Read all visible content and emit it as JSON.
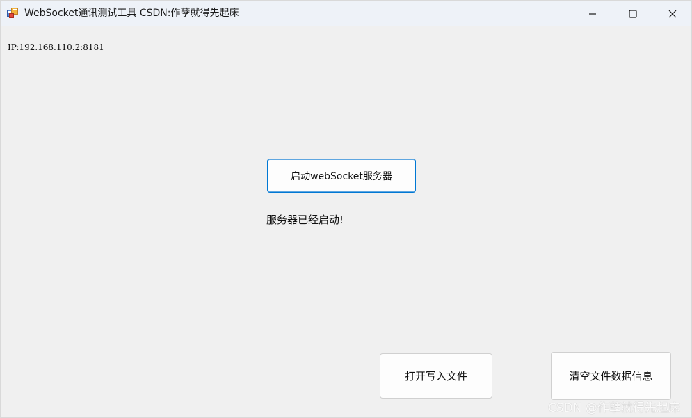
{
  "window": {
    "title": "WebSocket通讯测试工具 CSDN:作孽就得先起床",
    "controls": {
      "minimize": "minimize-icon",
      "maximize": "maximize-icon",
      "close": "close-icon"
    }
  },
  "main": {
    "ip_label": "IP:192.168.110.2:8181",
    "start_button_label": "启动webSocket服务器",
    "status_text": "服务器已经启动!",
    "open_file_button_label": "打开写入文件",
    "clear_file_button_label": "清空文件数据信息"
  },
  "watermark": "CSDN @作孽就得先起床",
  "colors": {
    "accent": "#0078d4",
    "background": "#f0f0f0",
    "titlebar": "#eef2f8"
  }
}
